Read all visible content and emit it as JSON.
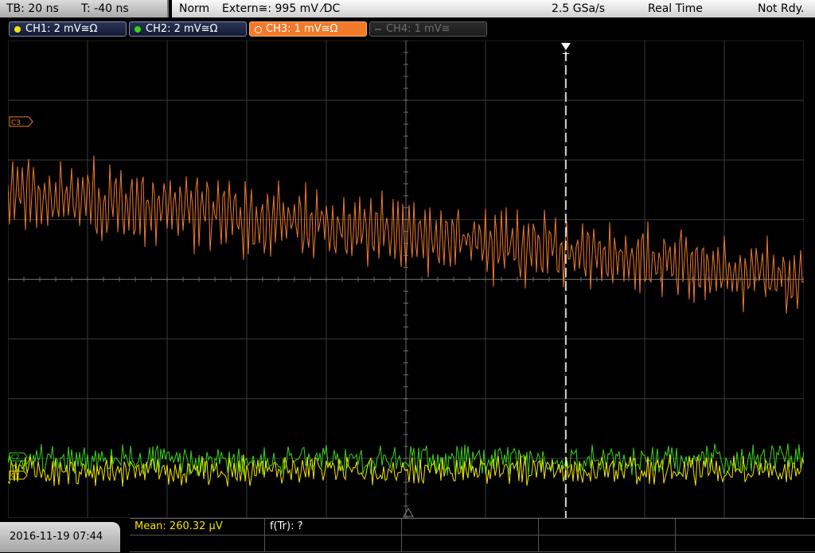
{
  "timebase": {
    "tb": "TB: 20 ns",
    "trigger_offset": "T: -40 ns"
  },
  "status": {
    "mode": "Norm",
    "trigger": "Extern≅: 995 mV ⁄DC",
    "sample_rate": "2.5 GSa/s",
    "acq_mode": "Real Time",
    "state": "Not Rdy."
  },
  "channels": [
    {
      "label": "CH1: 2 mV≅Ω",
      "color": "#f2e600",
      "state": "on"
    },
    {
      "label": "CH2: 2 mV≅Ω",
      "color": "#39d41a",
      "state": "on"
    },
    {
      "label": "CH3: 1 mV≅Ω",
      "color": "#f07a2a",
      "state": "selected"
    },
    {
      "label": "CH4: 1 mV≅",
      "color": "#555555",
      "state": "off"
    }
  ],
  "markers": {
    "ch3": "C3",
    "ch1": "C1",
    "ch2": "C2",
    "trigger": "T"
  },
  "measurements": {
    "mean": "Mean: 260.32 µV",
    "ftr": "f(Tr): ?"
  },
  "datetime": "2016-11-19 07:44",
  "colors": {
    "grid": "#3a3a3a",
    "grid_axis": "#6e6e6e",
    "ch3": "#f07a2a",
    "ch1": "#f2e600",
    "ch2": "#39d41a",
    "trigger": "#ffffff",
    "mean": "#f2e600"
  }
}
